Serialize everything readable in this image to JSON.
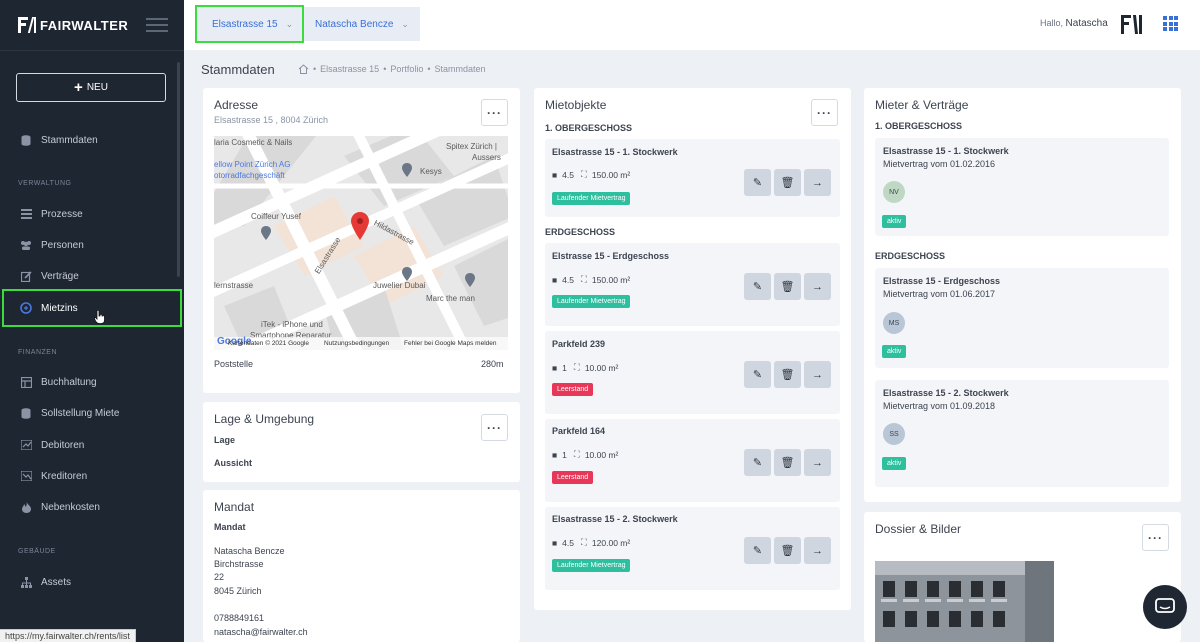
{
  "sidebar": {
    "brand": "FAIRWALTER",
    "new_button": "NEU",
    "items": {
      "stammdaten": "Stammdaten",
      "prozesse": "Prozesse",
      "personen": "Personen",
      "vertraege": "Verträge",
      "mietzins": "Mietzins",
      "buchhaltung": "Buchhaltung",
      "sollstellung": "Sollstellung Miete",
      "debitoren": "Debitoren",
      "kreditoren": "Kreditoren",
      "nebenkosten": "Nebenkosten",
      "assets": "Assets"
    },
    "sections": {
      "verwaltung": "VERWALTUNG",
      "finanzen": "FINANZEN",
      "gebaeude": "GEBÄUDE"
    }
  },
  "status_url": "https://my.fairwalter.ch/rents/list",
  "topbar": {
    "tab_property": "Elsastrasse 15",
    "tab_person": "Natascha Bencze",
    "hello": "Hallo,",
    "user": "Natascha"
  },
  "breadcrumb": {
    "title": "Stammdaten",
    "path": [
      "Elsastrasse 15",
      "Portfolio",
      "Stammdaten"
    ]
  },
  "adresse": {
    "title": "Adresse",
    "address": "Elsastrasse 15 , 8004 Zürich",
    "map_labels": {
      "cosmetic": "laria Cosmetic & Nails",
      "yellow_point": "ellow Point Zürich AG",
      "motorrad": "otorradfachgeschäft",
      "spitex": "Spitex Zürich |",
      "aussers": "Aussers",
      "kesys": "Kesys",
      "coiffeur": "Coiffeur Yusef",
      "hildastrasse": "Hildastrasse",
      "elsastrasse": "Elsastrasse",
      "ernstrasse": "lernstrasse",
      "juwelier": "Juwelier Dubai",
      "marc": "Marc the man",
      "itek1": "iTek - iPhone und",
      "itek2": "Smartphone Reparatur",
      "copyright": "Kartendaten © 2021 Google",
      "terms": "Nutzungsbedingungen",
      "report": "Fehler bei Google Maps melden",
      "google": "Google"
    },
    "poststelle": "Poststelle",
    "distance": "280m"
  },
  "lage": {
    "title": "Lage & Umgebung",
    "lage_label": "Lage",
    "aussicht_label": "Aussicht"
  },
  "mandat": {
    "title": "Mandat",
    "label": "Mandat",
    "name": "Natascha Bencze",
    "street": "Birchstrasse",
    "number": "22",
    "city": "8045 Zürich",
    "phone": "0788849161",
    "email": "natascha@fairwalter.ch"
  },
  "mietobjekte": {
    "title": "Mietobjekte",
    "section_og": "1. OBERGESCHOSS",
    "section_eg": "ERDGESCHOSS",
    "objects": [
      {
        "title": "Elsastrasse 15 - 1. Stockwerk",
        "rooms": "4.5",
        "area": "150.00 m²",
        "status": "Laufender Mietvertrag"
      },
      {
        "title": "Elstrasse 15 - Erdgeschoss",
        "rooms": "4.5",
        "area": "150.00 m²",
        "status": "Laufender Mietvertrag"
      },
      {
        "title": "Parkfeld 239",
        "rooms": "1",
        "area": "10.00 m²",
        "status": "Leerstand"
      },
      {
        "title": "Parkfeld 164",
        "rooms": "1",
        "area": "10.00 m²",
        "status": "Leerstand"
      },
      {
        "title": "Elsastrasse 15 - 2. Stockwerk",
        "rooms": "4.5",
        "area": "120.00 m²",
        "status": "Laufender Mietvertrag"
      }
    ]
  },
  "mieter": {
    "title": "Mieter & Verträge",
    "section_og": "1. OBERGESCHOSS",
    "section_eg": "ERDGESCHOSS",
    "tenants": [
      {
        "title": "Elsastrasse 15 - 1. Stockwerk",
        "contract": "Mietvertrag vom 01.02.2016",
        "initials": "NV",
        "status": "aktiv"
      },
      {
        "title": "Elstrasse 15 - Erdgeschoss",
        "contract": "Mietvertrag vom 01.06.2017",
        "initials": "MS",
        "status": "aktiv"
      },
      {
        "title": "Elsastrasse 15 - 2. Stockwerk",
        "contract": "Mietvertrag vom 01.09.2018",
        "initials": "SS",
        "status": "aktiv"
      }
    ]
  },
  "dossier": {
    "title": "Dossier & Bilder"
  }
}
